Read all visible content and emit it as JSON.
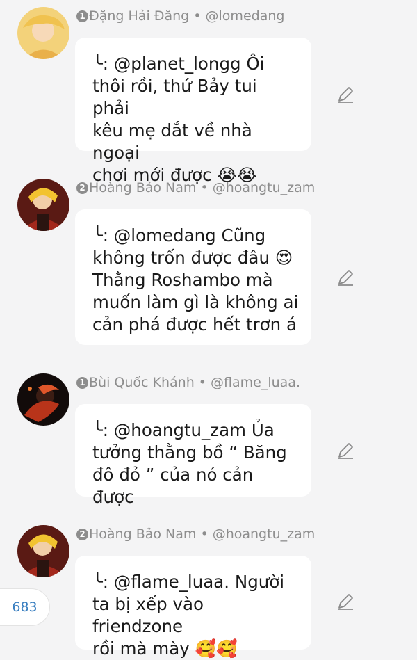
{
  "comments": [
    {
      "rank": "1",
      "name": "Đặng Hải Đăng",
      "sep": " • ",
      "handle": "@lomedang",
      "text": "╰: @planet_longg Ôi\nthôi rồi, thứ Bảy tui phải\nkêu mẹ dắt về nhà ngoại\nchơi mới được 😭😭"
    },
    {
      "rank": "2",
      "name": "Hoàng Bảo Nam",
      "sep": " • ",
      "handle": "@hoangtu_zam",
      "text": "╰: @lomedang Cũng\nkhông trốn được đâu 😍\nThằng Roshambo mà\nmuốn làm gì là không ai\ncản phá được hết trơn á"
    },
    {
      "rank": "1",
      "name": "Bùi Quốc Khánh",
      "sep": " • ",
      "handle": "@flame_luaa.",
      "text": "╰: @hoangtu_zam Ủa\ntưởng thằng bồ “ Băng\nđô đỏ ” của nó cản được"
    },
    {
      "rank": "2",
      "name": "Hoàng Bảo Nam",
      "sep": " • ",
      "handle": "@hoangtu_zam",
      "text": "╰: @flame_luaa. Người\nta bị xếp vào friendzone\nrồi mà mày 🥰🥰"
    }
  ],
  "counter": "683",
  "icons": {
    "edit": "pencil-icon"
  },
  "colors": {
    "background": "#f4f4f5",
    "bubble": "#ffffff",
    "meta": "#8d8d8d",
    "counter": "#3a7fc0"
  }
}
